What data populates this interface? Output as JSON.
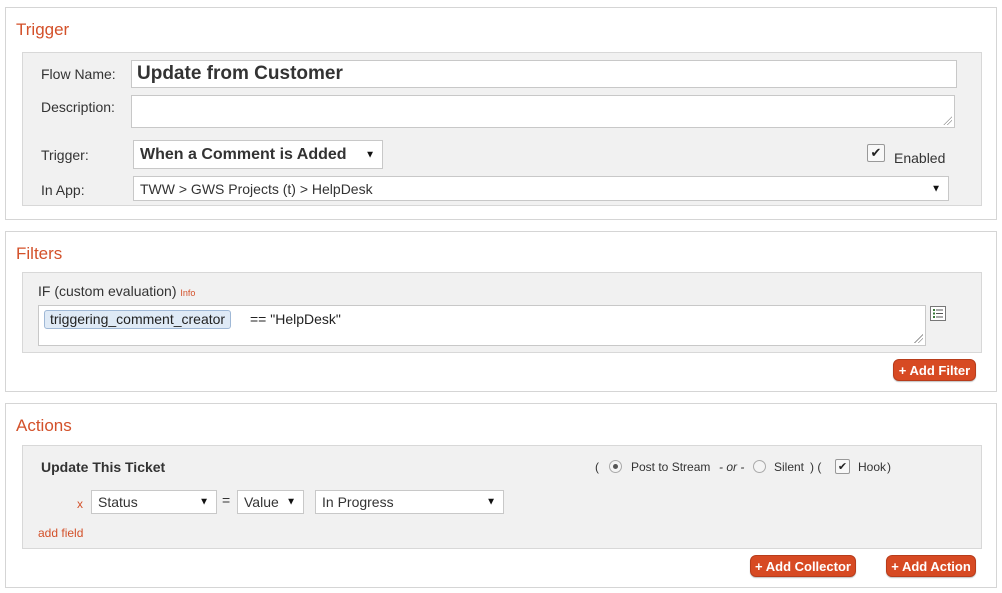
{
  "trigger": {
    "title": "Trigger",
    "flow_name_label": "Flow Name:",
    "flow_name_value": "Update from Customer",
    "description_label": "Description:",
    "description_value": "",
    "trigger_label": "Trigger:",
    "trigger_value": "When a Comment is Added",
    "enabled_label": "Enabled",
    "enabled_checked": true,
    "in_app_label": "In App:",
    "in_app_value": "TWW > GWS Projects (t) > HelpDesk"
  },
  "filters": {
    "title": "Filters",
    "if_label": "IF (custom evaluation)",
    "info_link": "Info",
    "token": "triggering_comment_creator",
    "expression_rest": "== \"HelpDesk\"",
    "add_filter_label": "+ Add Filter"
  },
  "actions": {
    "title": "Actions",
    "action_title": "Update This Ticket",
    "paren_open": "(",
    "post_to_stream_label": "Post to Stream",
    "or_label": "- or -",
    "silent_label": "Silent",
    "paren_close_open": ") (",
    "hook_label": "Hook",
    "paren_close": ")",
    "remove_label": "x",
    "field_value": "Status",
    "equals_label": "=",
    "mode_value": "Value",
    "status_value": "In Progress",
    "add_field_label": "add field",
    "add_collector_label": "+ Add Collector",
    "add_action_label": "+ Add Action"
  },
  "colors": {
    "accent": "#d3512a",
    "button": "#d74a23",
    "panel_bg": "#f1f1f1",
    "token_bg": "#dfeaf6"
  }
}
